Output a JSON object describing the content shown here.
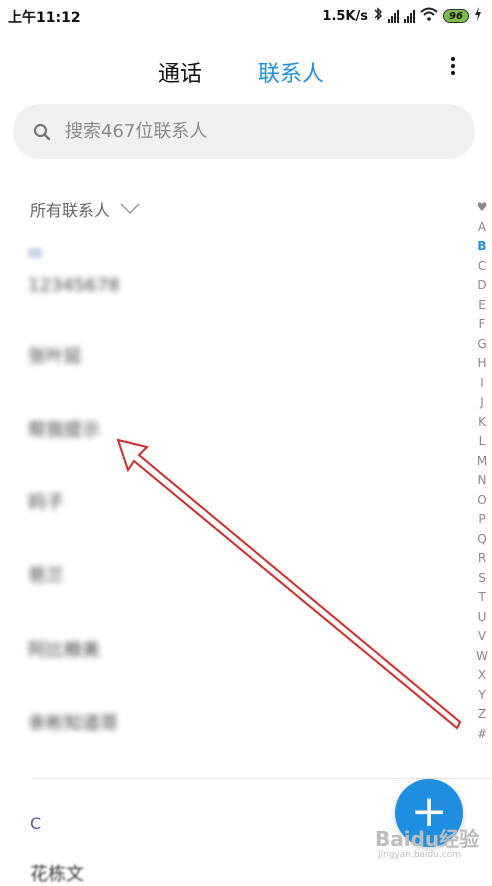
{
  "status_bar": {
    "time": "上午11:12",
    "speed": "1.5K/s",
    "battery": "96"
  },
  "header": {
    "tab_calls": "通话",
    "tab_contacts": "联系人"
  },
  "search": {
    "placeholder": "搜索467位联系人"
  },
  "group_filter": {
    "label": "所有联系人"
  },
  "contacts": [
    "12345678",
    "张叶延",
    "帮我提示",
    "妈子",
    "爸兰",
    "阿比粮美",
    "亲彬知道哥"
  ],
  "section_c": "C",
  "partial_row": "花栋文",
  "alpha_index": [
    "♥",
    "A",
    "B",
    "C",
    "D",
    "E",
    "F",
    "G",
    "H",
    "I",
    "J",
    "K",
    "L",
    "M",
    "N",
    "O",
    "P",
    "Q",
    "R",
    "S",
    "T",
    "U",
    "V",
    "W",
    "X",
    "Y",
    "Z",
    "#"
  ],
  "active_letter": "B",
  "fab": {
    "symbol": "+"
  },
  "watermark": {
    "text": "Baidu经验",
    "sub": "jingyan.baidu.com"
  },
  "colors": {
    "accent": "#1e8fe0",
    "annotation": "#d42a2a"
  }
}
